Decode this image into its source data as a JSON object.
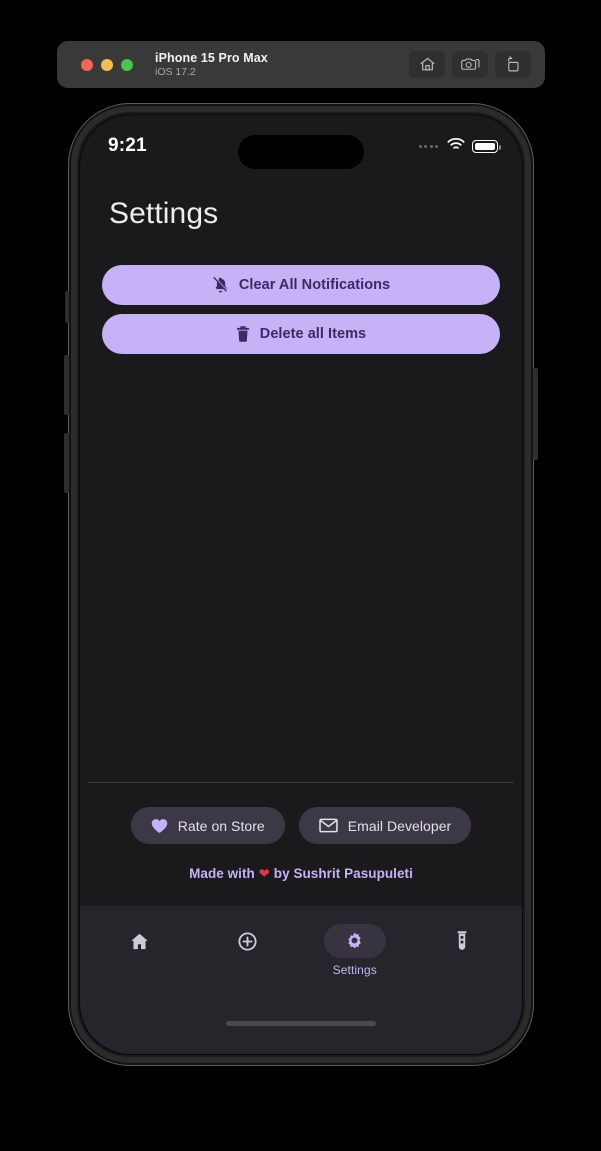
{
  "simulator": {
    "device_name": "iPhone 15 Pro Max",
    "os_version": "iOS 17.2",
    "traffic_lights": [
      {
        "name": "close",
        "color": "#f4645a"
      },
      {
        "name": "minimize",
        "color": "#f5bf4f"
      },
      {
        "name": "zoom",
        "color": "#45c84b"
      }
    ],
    "toolbar": [
      {
        "icon": "home-icon",
        "label": "Home"
      },
      {
        "icon": "screenshot-camera-icon",
        "label": "Screenshot"
      },
      {
        "icon": "rotate-icon",
        "label": "Rotate"
      }
    ]
  },
  "status_bar": {
    "time": "9:21",
    "signal_icon": "signal-dots-icon",
    "wifi_icon": "wifi-icon",
    "battery_icon": "battery-icon"
  },
  "screen": {
    "page_title": "Settings",
    "actions": [
      {
        "label": "Clear All Notifications",
        "icon": "bell-slash-icon"
      },
      {
        "label": "Delete all Items",
        "icon": "trash-icon"
      }
    ],
    "footer_links": [
      {
        "label": "Rate on Store",
        "icon": "heart-icon"
      },
      {
        "label": "Email Developer",
        "icon": "envelope-icon"
      }
    ],
    "credit": {
      "prefix": "Made with ",
      "heart": "❤",
      "suffix": " by Sushrit Pasupuleti"
    },
    "tabs": [
      {
        "label": "",
        "icon": "home-icon",
        "active": false
      },
      {
        "label": "",
        "icon": "plus-circle-icon",
        "active": false
      },
      {
        "label": "Settings",
        "icon": "gear-icon",
        "active": true
      },
      {
        "label": "",
        "icon": "test-tube-icon",
        "active": false
      }
    ]
  },
  "colors": {
    "accent_lavender": "#c6b2f6",
    "accent_text_dark": "#3c2a63",
    "screen_background": "#1a1a1c",
    "tabbar_background": "#27252c",
    "chip_background": "#3d3845",
    "active_pill_background": "#383341",
    "heart_red": "#e0383e"
  }
}
